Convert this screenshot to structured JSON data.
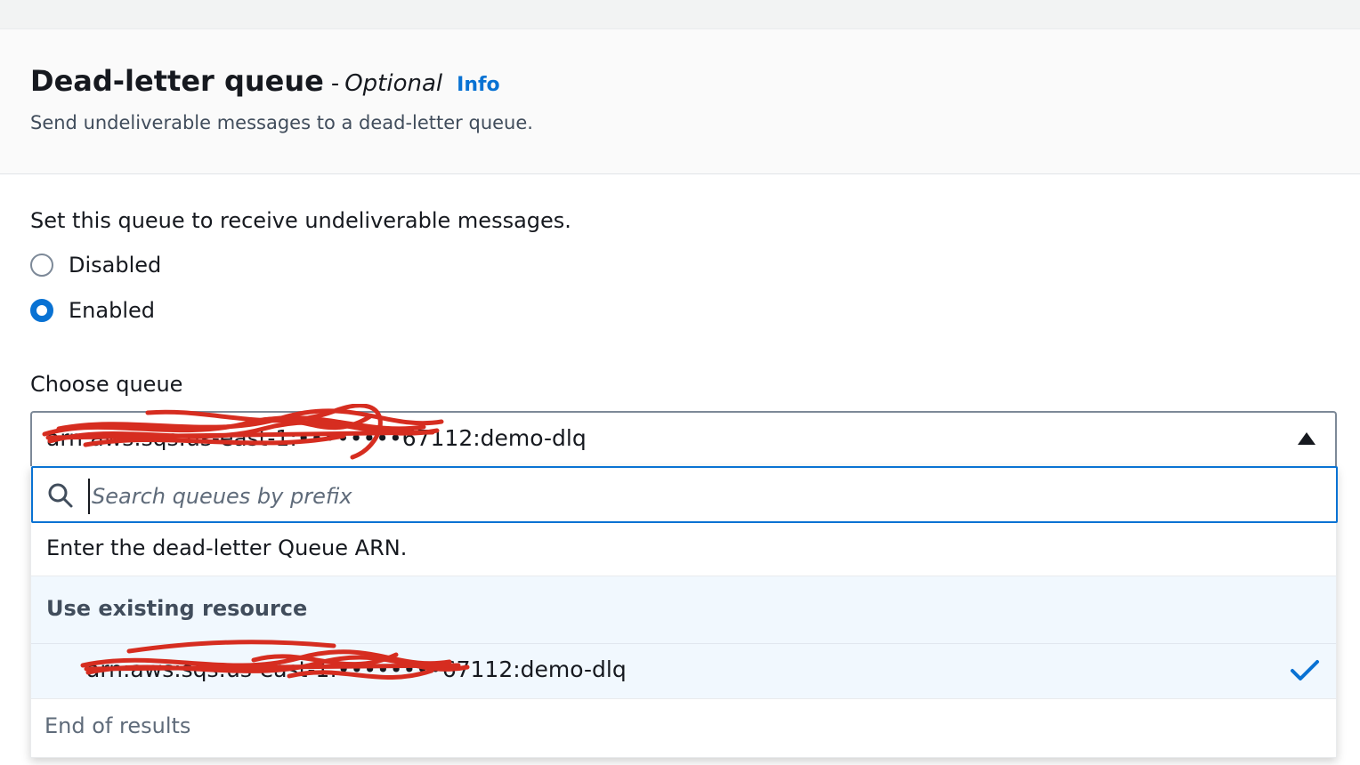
{
  "section": {
    "title": "Dead-letter queue",
    "separator": "-",
    "optional_label": "Optional",
    "info_link": "Info",
    "description": "Send undeliverable messages to a dead-letter queue."
  },
  "dlq_setting": {
    "prompt": "Set this queue to receive undeliverable messages.",
    "options": [
      {
        "label": "Disabled",
        "selected": false
      },
      {
        "label": "Enabled",
        "selected": true
      }
    ]
  },
  "choose_queue": {
    "label": "Choose queue",
    "selected_value": "arn:aws:sqs:us-east-1:••••••••67112:demo-dlq",
    "search_placeholder": "Search queues by prefix",
    "arn_hint": "Enter the dead-letter Queue ARN.",
    "group_label": "Use existing resource",
    "items": [
      {
        "label": "arn:aws:sqs:us-east-1:••••••••67112:demo-dlq",
        "selected": true
      }
    ],
    "end_label": "End of results"
  },
  "colors": {
    "accent": "#0972d3",
    "text": "#16191f",
    "muted": "#5f6b7a",
    "redaction": "#d62d20",
    "selected_bg": "#f1f8fe"
  },
  "icons": {
    "search": "search-icon",
    "caret": "caret-up-icon",
    "check": "check-icon"
  }
}
